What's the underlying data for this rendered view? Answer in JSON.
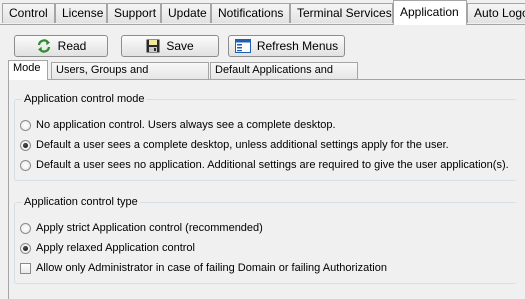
{
  "top_tabs": [
    "Control",
    "License",
    "Support",
    "Update",
    "Notifications",
    "Terminal Services",
    "Application",
    "Auto Logo"
  ],
  "active_top_tab": "Application",
  "toolbar": {
    "read_label": "Read",
    "save_label": "Save",
    "refresh_label": "Refresh Menus"
  },
  "sub_tabs": [
    "Mode",
    "Users, Groups and Applications",
    "Default Applications and Sets"
  ],
  "active_sub_tab": "Mode",
  "mode_group": {
    "title": "Application control mode",
    "options": [
      {
        "label": "No application control. Users always see a complete desktop.",
        "selected": false
      },
      {
        "label": "Default a user sees a complete desktop, unless additional settings apply for the user.",
        "selected": true
      },
      {
        "label": "Default a user sees no application. Additional settings are required to give the user application(s).",
        "selected": false
      }
    ]
  },
  "type_group": {
    "title": "Application control type",
    "options": [
      {
        "label": "Apply strict Application control (recommended)",
        "selected": false
      },
      {
        "label": "Apply relaxed Application control",
        "selected": true
      }
    ],
    "checkbox": {
      "label": "Allow only Administrator in case of failing Domain or failing Authorization",
      "checked": false
    }
  }
}
